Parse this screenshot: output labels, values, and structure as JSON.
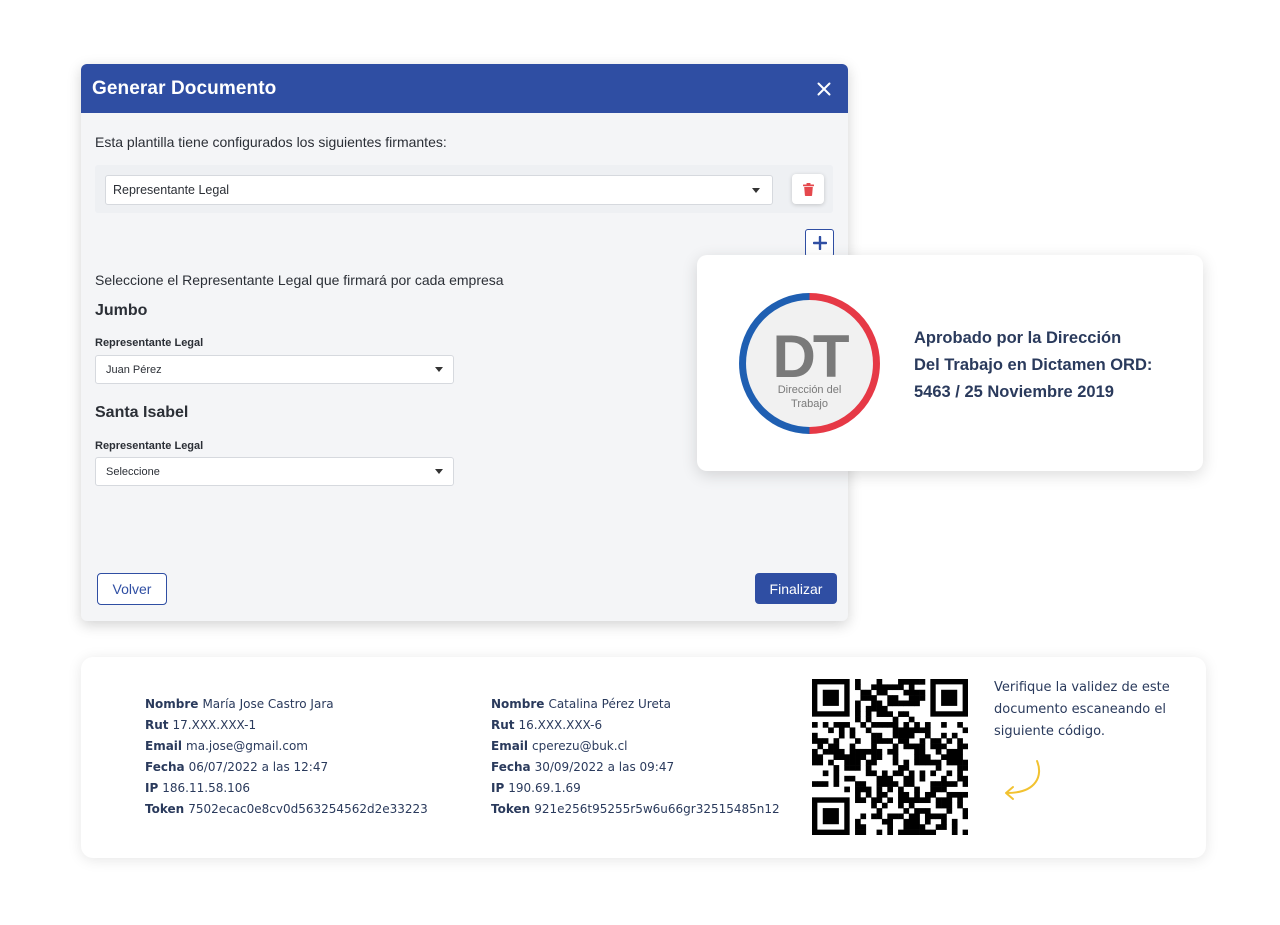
{
  "modal": {
    "title": "Generar Documento",
    "intro": "Esta plantilla tiene configurados los siguientes firmantes:",
    "signer_select_value": "Representante Legal",
    "instruction": "Seleccione el Representante Legal que firmará por cada empresa",
    "companies": [
      {
        "name": "Jumbo",
        "label": "Representante Legal",
        "value": "Juan Pérez"
      },
      {
        "name": "Santa Isabel",
        "label": "Representante Legal",
        "value": "Seleccione"
      }
    ],
    "back_label": "Volver",
    "finish_label": "Finalizar"
  },
  "dt_card": {
    "seal_initials": "DT",
    "seal_line1": "Dirección del",
    "seal_line2": "Trabajo",
    "text_line1": "Aprobado por la Dirección",
    "text_line2": "Del Trabajo en Dictamen ORD:",
    "text_line3": "5463 / 25 Noviembre 2019"
  },
  "signature_card": {
    "signers": [
      {
        "nombre_label": "Nombre",
        "nombre": "María Jose Castro Jara",
        "rut_label": "Rut",
        "rut": "17.XXX.XXX-1",
        "email_label": "Email",
        "email": "ma.jose@gmail.com",
        "fecha_label": "Fecha",
        "fecha": "06/07/2022 a las 12:47",
        "ip_label": "IP",
        "ip": "186.11.58.106",
        "token_label": "Token",
        "token": "7502ecac0e8cv0d563254562d2e33223"
      },
      {
        "nombre_label": "Nombre",
        "nombre": "Catalina Pérez Ureta",
        "rut_label": "Rut",
        "rut": "16.XXX.XXX-6",
        "email_label": "Email",
        "email": "cperezu@buk.cl",
        "fecha_label": "Fecha",
        "fecha": "30/09/2022 a las 09:47",
        "ip_label": "IP",
        "ip": "190.69.1.69",
        "token_label": "Token",
        "token": "921e256t95255r5w6u66gr32515485n12"
      }
    ],
    "verify_line1": "Verifique la validez de este",
    "verify_line2": "documento escaneando el",
    "verify_line3": "siguiente código."
  },
  "colors": {
    "primary": "#2f4ea3",
    "danger": "#e5484d",
    "seal_blue": "#1f5fb2",
    "seal_red": "#e63946",
    "arrow_yellow": "#f2c230"
  },
  "icons": [
    "close-icon",
    "caret-down-icon",
    "trash-icon",
    "plus-icon",
    "qr-code-icon",
    "curved-arrow-icon"
  ]
}
